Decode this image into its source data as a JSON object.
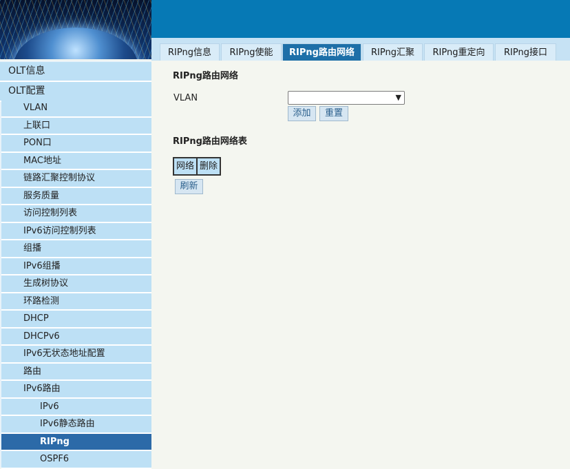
{
  "header": {
    "tabs": [
      {
        "label": "RIPng信息",
        "active": false
      },
      {
        "label": "RIPng使能",
        "active": false
      },
      {
        "label": "RIPng路由网络",
        "active": true
      },
      {
        "label": "RIPng汇聚",
        "active": false
      },
      {
        "label": "RIPng重定向",
        "active": false
      },
      {
        "label": "RIPng接口",
        "active": false
      }
    ]
  },
  "sidebar": {
    "items": [
      {
        "label": "OLT信息",
        "level": 0
      },
      {
        "label": "OLT配置",
        "level": 0
      },
      {
        "label": "VLAN",
        "level": 1
      },
      {
        "label": "上联口",
        "level": 1
      },
      {
        "label": "PON口",
        "level": 1
      },
      {
        "label": "MAC地址",
        "level": 1
      },
      {
        "label": "链路汇聚控制协议",
        "level": 1
      },
      {
        "label": "服务质量",
        "level": 1
      },
      {
        "label": "访问控制列表",
        "level": 1
      },
      {
        "label": "IPv6访问控制列表",
        "level": 1
      },
      {
        "label": "组播",
        "level": 1
      },
      {
        "label": "IPv6组播",
        "level": 1
      },
      {
        "label": "生成树协议",
        "level": 1
      },
      {
        "label": "环路检测",
        "level": 1
      },
      {
        "label": "DHCP",
        "level": 1
      },
      {
        "label": "DHCPv6",
        "level": 1
      },
      {
        "label": "IPv6无状态地址配置",
        "level": 1
      },
      {
        "label": "路由",
        "level": 1
      },
      {
        "label": "IPv6路由",
        "level": 1
      },
      {
        "label": "IPv6",
        "level": 2
      },
      {
        "label": "IPv6静态路由",
        "level": 2
      },
      {
        "label": "RIPng",
        "level": 2,
        "active": true
      },
      {
        "label": "OSPF6",
        "level": 2
      }
    ]
  },
  "main": {
    "section_title": "RIPng路由网络",
    "vlan_label": "VLAN",
    "vlan_value": "",
    "add_label": "添加",
    "reset_label": "重置",
    "table_title": "RIPng路由网络表",
    "table_headers": [
      "网络",
      "删除"
    ],
    "refresh_label": "刷新"
  },
  "colors": {
    "header": "#0679b5",
    "menu_bg": "#bde0f5",
    "active": "#2c6aa8"
  }
}
